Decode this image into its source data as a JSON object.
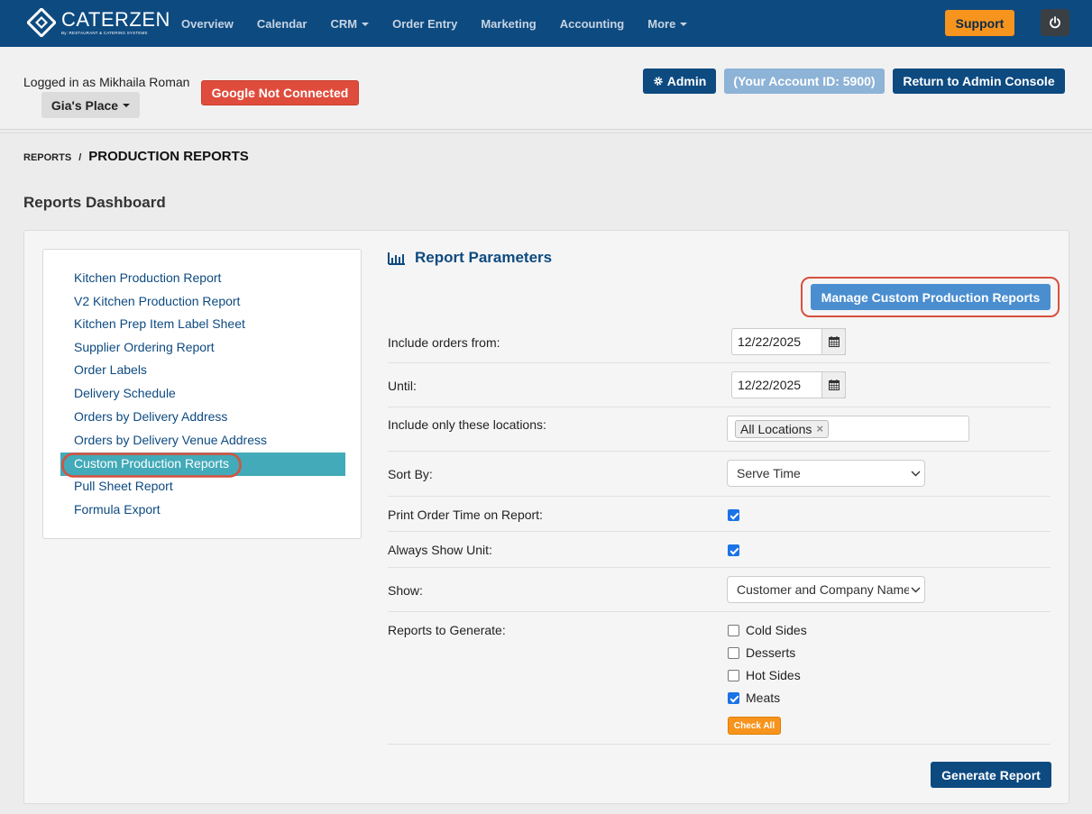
{
  "brand": {
    "name": "CaterZen",
    "tagline": "By: RESTAURANT & CATERING SYSTEMS"
  },
  "nav": {
    "items": [
      "Overview",
      "Calendar",
      "CRM",
      "Order Entry",
      "Marketing",
      "Accounting",
      "More"
    ],
    "support_label": "Support"
  },
  "account": {
    "logged_in_text": "Logged in as Mikhaila Roman",
    "location": "Gia's Place",
    "google_status": "Google Not Connected",
    "admin_label": "Admin",
    "account_id_label": "(Your Account ID: 5900)",
    "return_label": "Return to Admin Console"
  },
  "breadcrumb": {
    "parent": "REPORTS",
    "separator": "/",
    "current": "PRODUCTION REPORTS"
  },
  "page_title": "Reports Dashboard",
  "sidebar": {
    "items": [
      "Kitchen Production Report",
      "V2 Kitchen Production Report",
      "Kitchen Prep Item Label Sheet",
      "Supplier Ordering Report",
      "Order Labels",
      "Delivery Schedule",
      "Orders by Delivery Address",
      "Orders by Delivery Venue Address",
      "Custom Production Reports",
      "Pull Sheet Report",
      "Formula Export"
    ],
    "active_item": "Custom Production Reports"
  },
  "params": {
    "title": "Report Parameters",
    "manage_label": "Manage Custom Production Reports",
    "include_from_label": "Include orders from:",
    "include_from_value": "12/22/2025",
    "until_label": "Until:",
    "until_value": "12/22/2025",
    "locations_label": "Include only these locations:",
    "locations_tag": "All Locations",
    "sort_label": "Sort By:",
    "sort_value": "Serve Time",
    "print_time_label": "Print Order Time on Report:",
    "print_time_checked": true,
    "show_unit_label": "Always Show Unit:",
    "show_unit_checked": true,
    "show_label": "Show:",
    "show_value": "Customer and Company Name",
    "reports_label": "Reports to Generate:",
    "reports": [
      {
        "label": "Cold Sides",
        "checked": false
      },
      {
        "label": "Desserts",
        "checked": false
      },
      {
        "label": "Hot Sides",
        "checked": false
      },
      {
        "label": "Meats",
        "checked": true
      }
    ],
    "check_all_label": "Check All",
    "generate_label": "Generate Report"
  },
  "colors": {
    "nav_bg": "#0d4a80",
    "accent": "#f7941d",
    "active_item": "#42aab8",
    "highlight_ring": "#d9503d"
  }
}
